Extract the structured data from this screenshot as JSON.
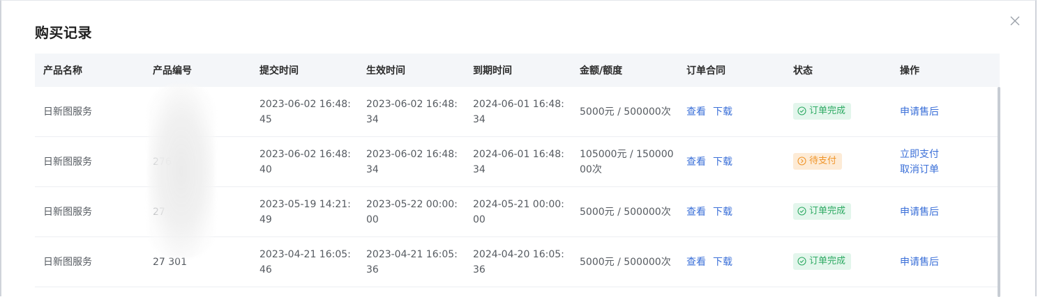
{
  "dialog": {
    "title": "购买记录"
  },
  "table": {
    "headers": [
      "产品名称",
      "产品编号",
      "提交时间",
      "生效时间",
      "到期时间",
      "金额/额度",
      "订单合同",
      "状态",
      "操作"
    ],
    "rows": [
      {
        "product_name": "日新图服务",
        "product_no": "",
        "submit_time": "2023-06-02 16:48:45",
        "effective_time": "2023-06-02 16:48:34",
        "expire_time": "2024-06-01 16:48:34",
        "amount": "5000元 / 500000次",
        "contract_view": "查看",
        "contract_download": "下载",
        "status": "订单完成",
        "status_type": "done",
        "actions": [
          "申请售后"
        ]
      },
      {
        "product_name": "日新图服务",
        "product_no": "276",
        "submit_time": "2023-06-02 16:48:40",
        "effective_time": "2023-06-02 16:48:34",
        "expire_time": "2024-06-01 16:48:34",
        "amount": "105000元 / 15000000次",
        "contract_view": "查看",
        "contract_download": "下载",
        "status": "待支付",
        "status_type": "pending",
        "actions": [
          "立即支付",
          "取消订单"
        ]
      },
      {
        "product_name": "日新图服务",
        "product_no": "27",
        "submit_time": "2023-05-19 14:21:49",
        "effective_time": "2023-05-22 00:00:00",
        "expire_time": "2024-05-21 00:00:00",
        "amount": "5000元 / 500000次",
        "contract_view": "查看",
        "contract_download": "下载",
        "status": "订单完成",
        "status_type": "done",
        "actions": [
          "申请售后"
        ]
      },
      {
        "product_name": "日新图服务",
        "product_no": "27    301",
        "submit_time": "2023-04-21 16:05:46",
        "effective_time": "2023-04-21 16:05:36",
        "expire_time": "2024-04-20 16:05:36",
        "amount": "5000元 / 500000次",
        "contract_view": "查看",
        "contract_download": "下载",
        "status": "订单完成",
        "status_type": "done",
        "actions": [
          "申请售后"
        ]
      }
    ]
  },
  "icons": {
    "close": "close-icon",
    "done": "check-circle-icon",
    "pending": "clock-circle-icon"
  },
  "colors": {
    "link": "#3a6fd8",
    "done_bg": "#e3f6ec",
    "done_fg": "#2eaa63",
    "pending_bg": "#fdebd6",
    "pending_fg": "#f0952a",
    "header_bg": "#f4f6f9"
  }
}
